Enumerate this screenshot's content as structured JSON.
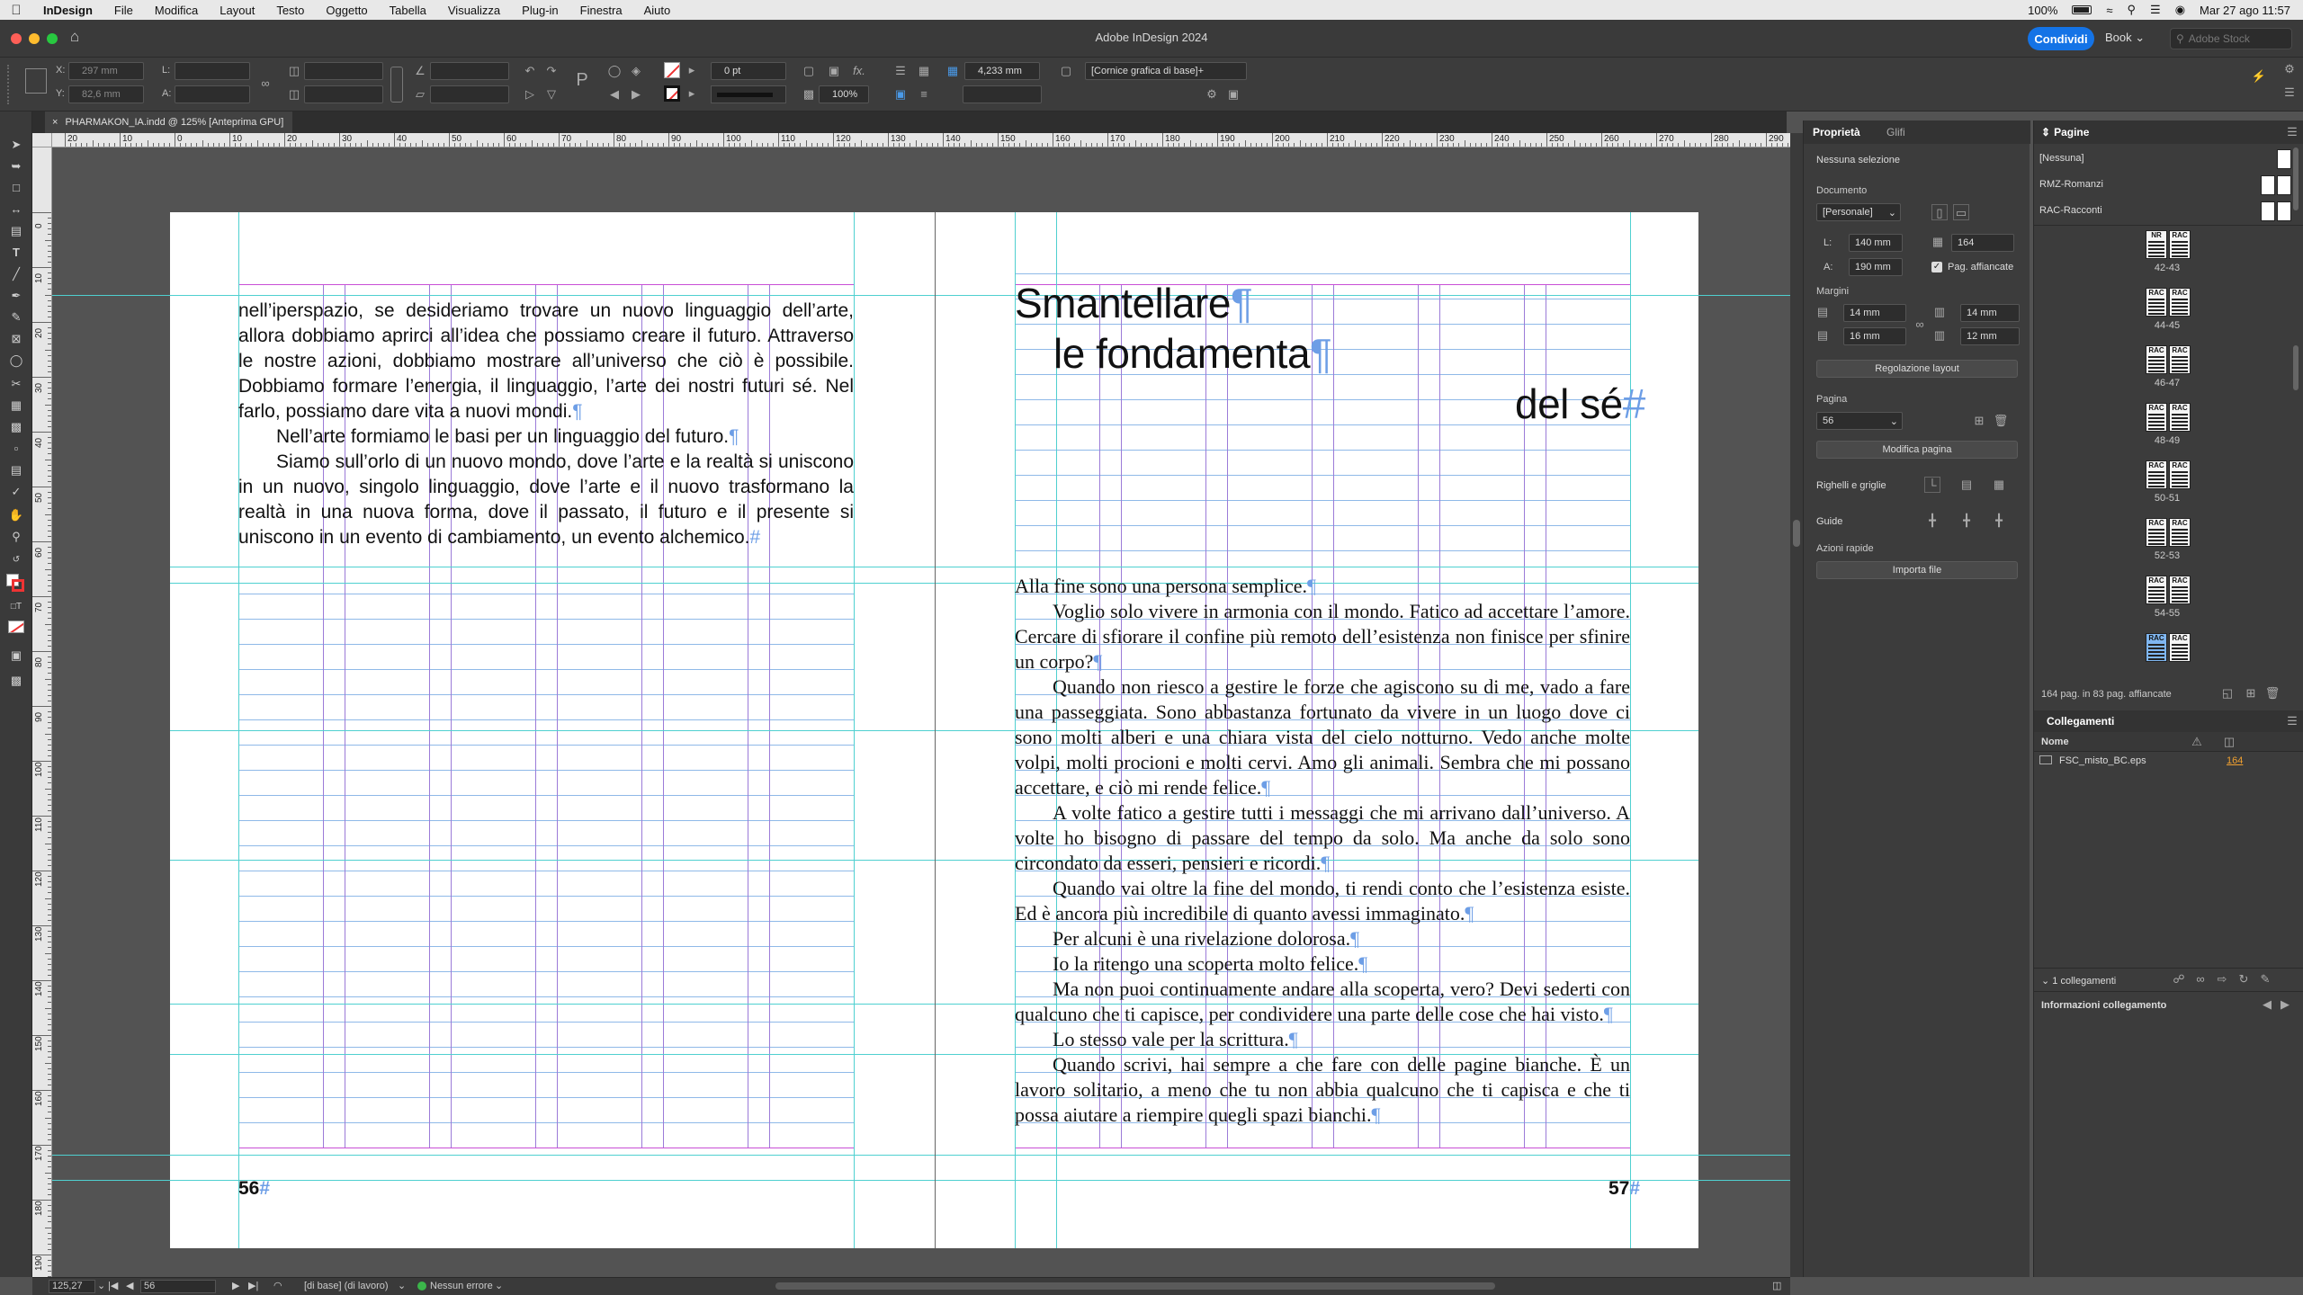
{
  "menubar": {
    "app": "InDesign",
    "items": [
      "File",
      "Modifica",
      "Layout",
      "Testo",
      "Oggetto",
      "Tabella",
      "Visualizza",
      "Plug-in",
      "Finestra",
      "Aiuto"
    ],
    "battery": "100%",
    "datetime": "Mar 27 ago  11:57"
  },
  "titlebar": {
    "title": "Adobe InDesign 2024",
    "share": "Condividi",
    "workspace": "Book",
    "stock_placeholder": "Adobe Stock"
  },
  "control": {
    "x_label": "X:",
    "x_value": "297 mm",
    "y_label": "Y:",
    "y_value": "82,6 mm",
    "w_label": "L:",
    "h_label": "A:",
    "stroke_weight": "0 pt",
    "dimension": "4,233 mm",
    "scale": "100%",
    "object_style": "[Cornice grafica di base]+"
  },
  "document_tab": {
    "close": "×",
    "title": "PHARMAKON_IA.indd @ 125% [Anteprima GPU]"
  },
  "ruler_labels": [
    "20",
    "10",
    "0",
    "10",
    "20",
    "30",
    "40",
    "50",
    "60",
    "70",
    "80",
    "90",
    "100",
    "110",
    "120",
    "130",
    "140",
    "150",
    "160",
    "170",
    "180",
    "190",
    "200",
    "210",
    "220",
    "230",
    "240",
    "250",
    "260",
    "270",
    "280",
    "290"
  ],
  "vruler_labels": [
    "0",
    "10",
    "20",
    "30",
    "40",
    "50",
    "60",
    "70",
    "80",
    "90",
    "100",
    "110",
    "120",
    "130",
    "140",
    "150",
    "160",
    "170",
    "180",
    "190"
  ],
  "left_page": {
    "paragraphs": [
      {
        "text": "nell’iperspazio, se desideriamo trovare un nuovo linguaggio dell’arte, allora dobbiamo aprirci all’idea che possiamo creare il futuro. Attraverso le nostre azioni, dobbiamo mostrare all’universo che ciò è possibile. Dobbiamo formare l’energia, il linguaggio, l’arte dei nostri futuri sé. Nel farlo, possiamo dare vita a nuovi mondi.",
        "indent": false,
        "mark": "¶"
      },
      {
        "text": "Nell’arte formiamo le basi per un linguaggio del futuro.",
        "indent": true,
        "mark": "¶"
      },
      {
        "text": "Siamo sull’orlo di un nuovo mondo, dove l’arte e la realtà si uniscono in un nuovo, singolo linguaggio, dove l’arte e il nuovo trasformano la realtà in una nuova forma, dove il passato, il futuro e il presente si uniscono in un evento di cambiamento, un evento alchemico.",
        "indent": true,
        "mark": "#"
      }
    ],
    "folio": "56"
  },
  "right_page": {
    "title_line1": "Smantellare",
    "title_line2": "le fondamenta",
    "title_line3": "del sé",
    "paragraphs": [
      {
        "text": "Alla fine sono una persona semplice.",
        "indent": false
      },
      {
        "text": "Voglio solo vivere in armonia con il mondo. Fatico ad accettare l’amore. Cercare di sfiorare il confine più remoto dell’esistenza non finisce per sfinire un corpo?",
        "indent": true
      },
      {
        "text": "Quando non riesco a gestire le forze che agiscono su di me, vado a fare una passeggiata. Sono abbastanza fortunato da vivere in un luogo dove ci sono molti alberi e una chiara vista del cielo notturno. Vedo anche molte volpi, molti procioni e molti cervi. Amo gli animali. Sembra che mi possano accettare, e ciò mi rende felice.",
        "indent": true
      },
      {
        "text": "A volte fatico a gestire tutti i messaggi che mi arrivano dall’universo. A volte ho bisogno di passare del tempo da solo. Ma anche da solo sono circondato da esseri, pensieri e ricordi.",
        "indent": true
      },
      {
        "text": "Quando vai oltre la fine del mondo, ti rendi conto che l’esistenza esiste. Ed è ancora più incredibile di quanto avessi immaginato.",
        "indent": true
      },
      {
        "text": "Per alcuni è una rivelazione dolorosa.",
        "indent": true
      },
      {
        "text": "Io la ritengo una scoperta molto felice.",
        "indent": true
      },
      {
        "text": "Ma non puoi continuamente andare alla scoperta, vero? Devi sederti con qualcuno che ti capisce, per condividere una parte delle cose che hai visto.",
        "indent": true
      },
      {
        "text": "Lo stesso vale per la scrittura.",
        "indent": true
      },
      {
        "text": "Quando scrivi, hai sempre a che fare con delle pagine bianche. È un lavoro solitario, a meno che tu non abbia qualcuno che ti capisca e che ti possa aiutare a riempire quegli spazi bianchi.",
        "indent": true
      }
    ],
    "pilcrow": "¶",
    "folio": "57"
  },
  "statusbar": {
    "zoom": "125,27",
    "page": "56",
    "master": "[di base] (di lavoro)",
    "preflight": "Nessun errore"
  },
  "properties": {
    "tabs": [
      "Proprietà",
      "Glifi"
    ],
    "selection": "Nessuna selezione",
    "document_label": "Documento",
    "preset": "[Personale]",
    "w_label": "L:",
    "width": "140 mm",
    "h_label": "A:",
    "height": "190 mm",
    "pages": "164",
    "facing": "Pag. affiancate",
    "margins_label": "Margini",
    "margin_top": "14 mm",
    "margin_bottom": "16 mm",
    "margin_inside": "14 mm",
    "margin_outside": "12 mm",
    "adjust_layout": "Regolazione layout",
    "page_label": "Pagina",
    "page_value": "56",
    "edit_page": "Modifica pagina",
    "rulers_grids": "Righelli e griglie",
    "guides": "Guide",
    "quick_actions": "Azioni rapide",
    "import_file": "Importa file"
  },
  "pages_panel": {
    "title": "Pagine",
    "masters": [
      "[Nessuna]",
      "RMZ-Romanzi",
      "RAC-Racconti"
    ],
    "spreads": [
      {
        "label": "42-43",
        "m1": "NR",
        "m2": "RAC"
      },
      {
        "label": "44-45",
        "m1": "RAC",
        "m2": "RAC"
      },
      {
        "label": "46-47",
        "m1": "RAC",
        "m2": "RAC"
      },
      {
        "label": "48-49",
        "m1": "RAC",
        "m2": "RAC"
      },
      {
        "label": "50-51",
        "m1": "RAC",
        "m2": "RAC"
      },
      {
        "label": "52-53",
        "m1": "RAC",
        "m2": "RAC"
      },
      {
        "label": "54-55",
        "m1": "RAC",
        "m2": "RAC"
      },
      {
        "label": "",
        "m1": "RAC",
        "m2": "RAC"
      }
    ],
    "footer": "164 pag. in 83 pag. affiancate"
  },
  "links_panel": {
    "title": "Collegamenti",
    "col_name": "Nome",
    "link_name": "FSC_misto_BC.eps",
    "link_page": "164",
    "count": "1 collegamenti",
    "info": "Informazioni collegamento"
  },
  "colors": {
    "accent": "#1473e6",
    "margin_guide": "#c94fd6",
    "column_guide": "#9b7bd8",
    "baseline_grid": "#8fb9e8",
    "ruler_guide": "#4fd0d0"
  }
}
